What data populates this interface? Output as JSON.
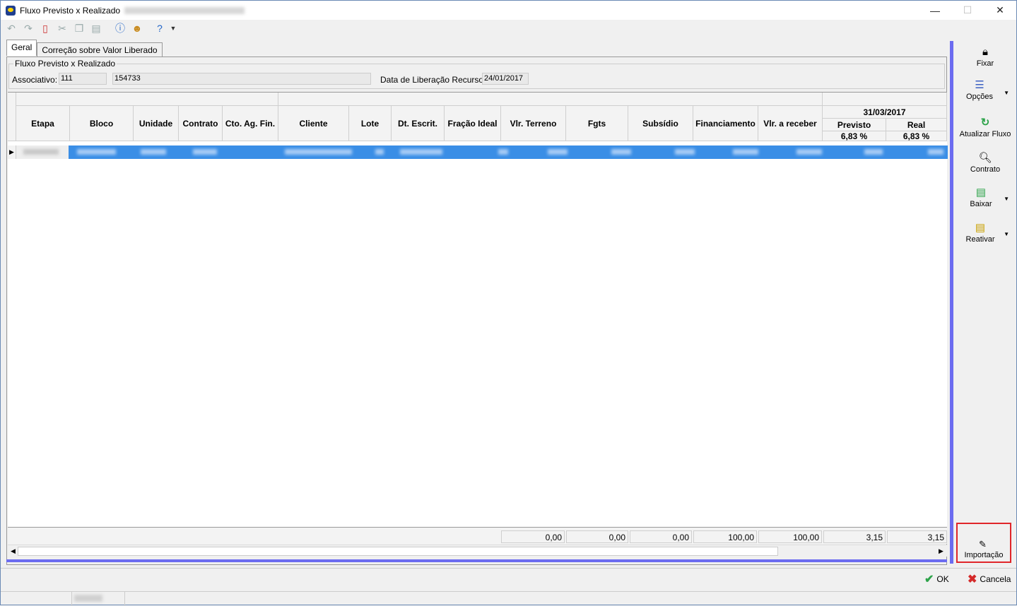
{
  "window": {
    "title": "Fluxo Previsto x Realizado",
    "minimize": "—",
    "maximize": "☐",
    "close": "✕"
  },
  "tabs": [
    {
      "label": "Geral"
    },
    {
      "label": "Correção sobre Valor Liberado"
    }
  ],
  "group": {
    "title": "Fluxo Previsto x Realizado"
  },
  "fields": {
    "associativo_label": "Associativo:",
    "associativo_code": "111",
    "associativo_name": "154733",
    "liberacao_label": "Data de Liberação Recursos:",
    "liberacao_value": "24/01/2017"
  },
  "grid": {
    "columns": [
      "Etapa",
      "Bloco",
      "Unidade",
      "Contrato",
      "Cto. Ag. Fin.",
      "Cliente",
      "Lote",
      "Dt. Escrit.",
      "Fração Ideal",
      "Vlr. Terreno",
      "Fgts",
      "Subsídio",
      "Financiamento",
      "Vlr. a receber"
    ],
    "date_group": "31/03/2017",
    "sub_columns": [
      {
        "label": "Previsto",
        "pct": "6,83 %"
      },
      {
        "label": "Real",
        "pct": "6,83 %"
      }
    ],
    "totals": [
      "0,00",
      "0,00",
      "0,00",
      "100,00",
      "100,00",
      "3,15",
      "3,15"
    ]
  },
  "sidebar": [
    {
      "label": "Fixar",
      "icon": "lock-icon"
    },
    {
      "label": "Opções",
      "icon": "list-icon"
    },
    {
      "label": "Atualizar Fluxo",
      "icon": "refresh-icon"
    },
    {
      "label": "Contrato",
      "icon": "search-document-icon"
    },
    {
      "label": "Baixar",
      "icon": "download-icon"
    },
    {
      "label": "Reativar",
      "icon": "reactivate-icon"
    }
  ],
  "importacao": {
    "label": "Importação"
  },
  "buttons": {
    "ok": "OK",
    "cancel": "Cancela"
  },
  "colors": {
    "selection": "#3a8ee6",
    "accent_bar": "#6c6cf0",
    "highlight": "#e0262a"
  }
}
